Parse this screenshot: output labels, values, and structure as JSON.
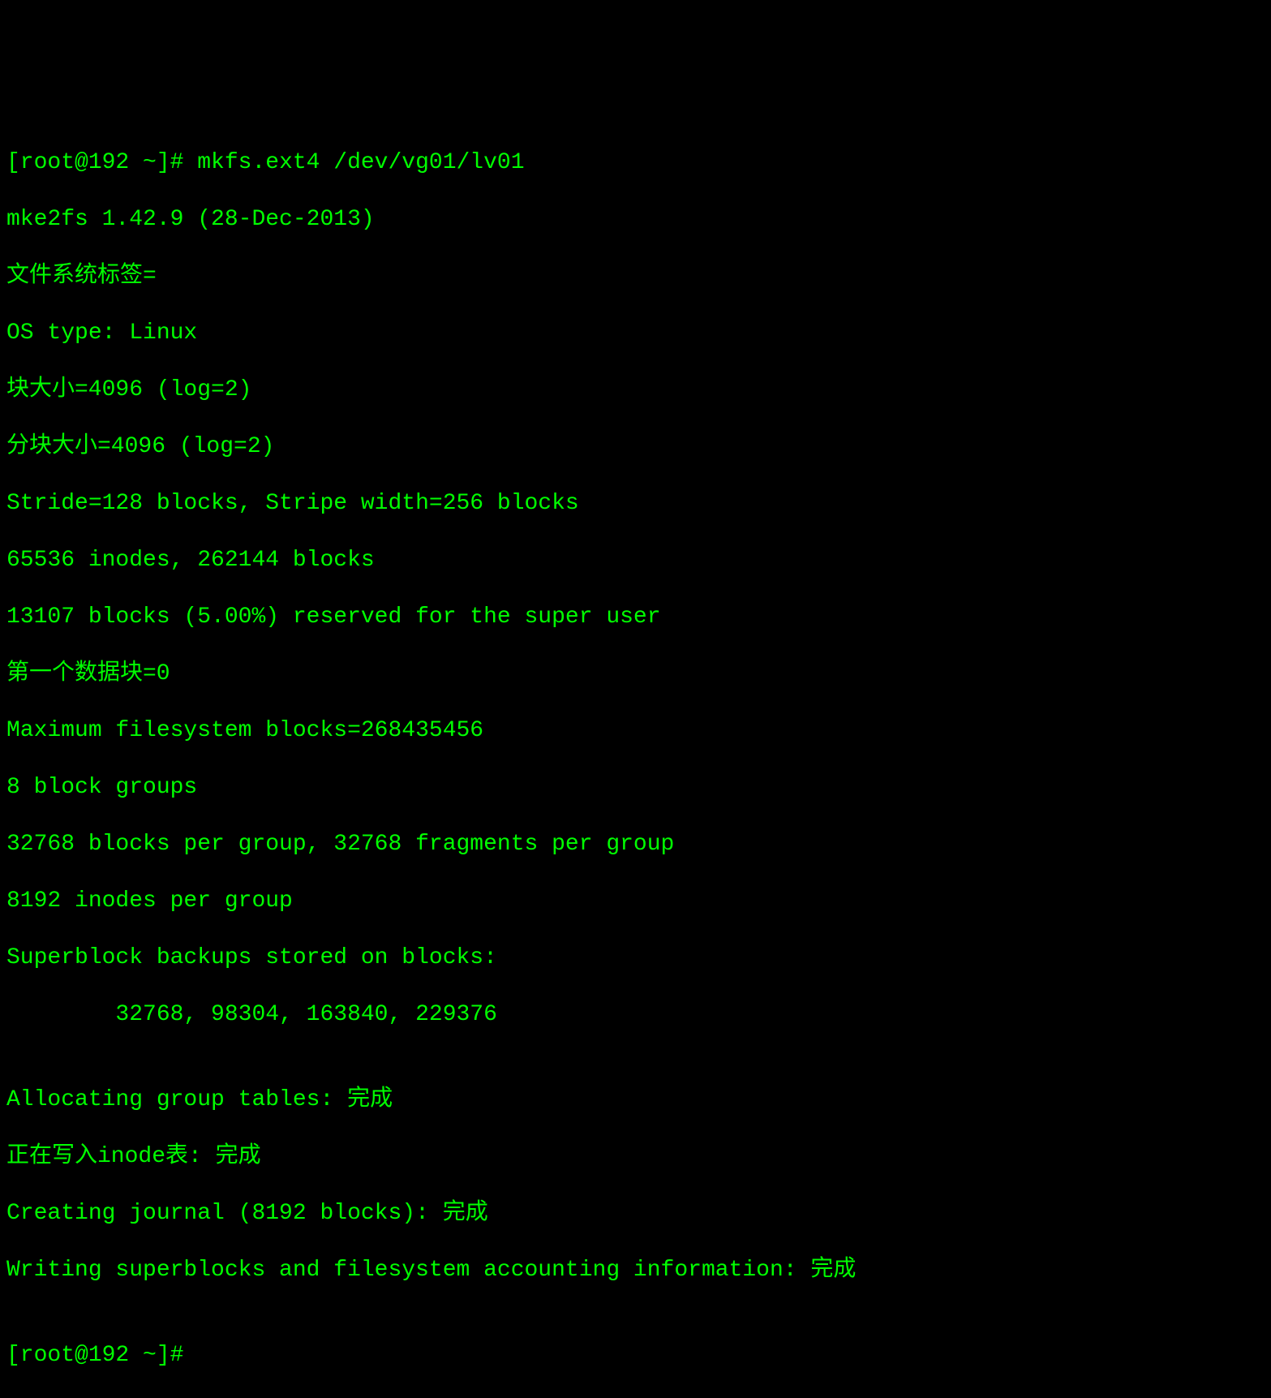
{
  "terminal": {
    "prompt1": "[root@192 ~]# ",
    "command1": "mkfs.ext4 /dev/vg01/lv01",
    "output_lines": [
      "mke2fs 1.42.9 (28-Dec-2013)",
      "文件系统标签=",
      "OS type: Linux",
      "块大小=4096 (log=2)",
      "分块大小=4096 (log=2)",
      "Stride=128 blocks, Stripe width=256 blocks",
      "65536 inodes, 262144 blocks",
      "13107 blocks (5.00%) reserved for the super user",
      "第一个数据块=0",
      "Maximum filesystem blocks=268435456",
      "8 block groups",
      "32768 blocks per group, 32768 fragments per group",
      "8192 inodes per group",
      "Superblock backups stored on blocks: ",
      "\t32768, 98304, 163840, 229376",
      "",
      "Allocating group tables: 完成                            ",
      "正在写入inode表: 完成                            ",
      "Creating journal (8192 blocks): 完成",
      "Writing superblocks and filesystem accounting information: 完成",
      ""
    ],
    "prompt2": "[root@192 ~]# "
  }
}
